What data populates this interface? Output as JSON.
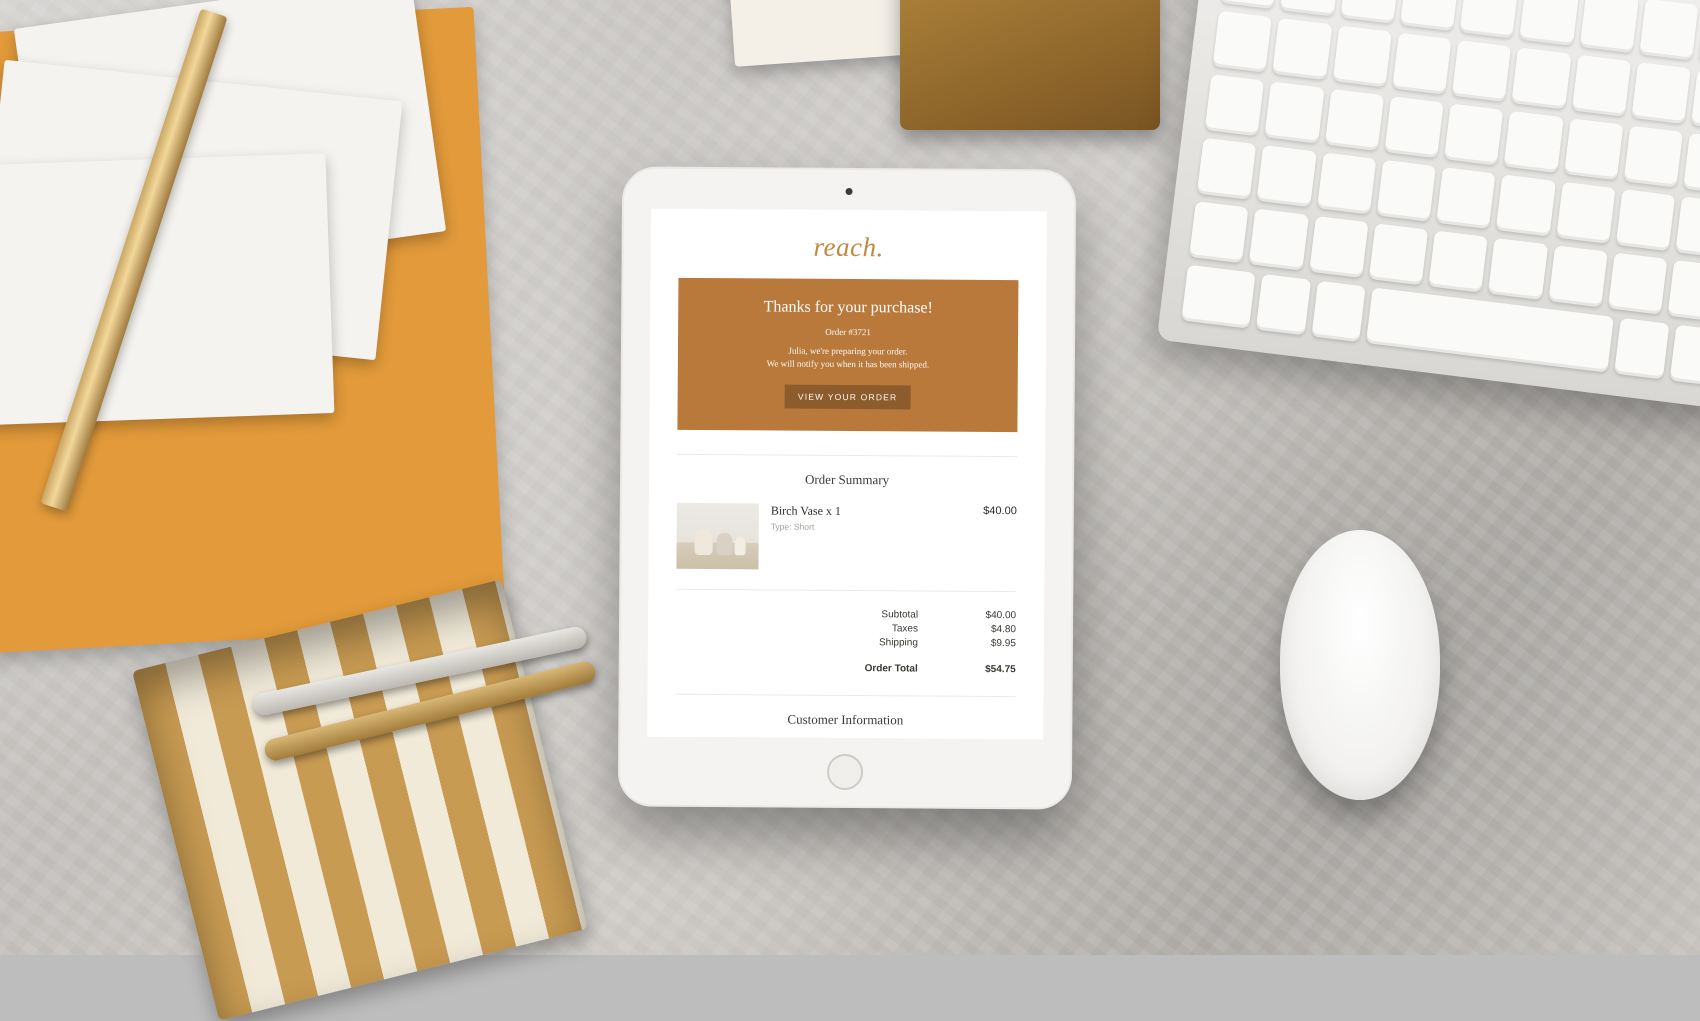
{
  "brand": "reach.",
  "hero": {
    "title": "Thanks for your purchase!",
    "order_label": "Order #3721",
    "message_line1": "Julia, we're preparing your order.",
    "message_line2": "We will notify you when it has been shipped.",
    "button": "VIEW  YOUR ORDER"
  },
  "sections": {
    "order_summary": "Order Summary",
    "customer_info": "Customer Information"
  },
  "line_item": {
    "name": "Birch Vase x 1",
    "type_label": "Type: Short",
    "price": "$40.00"
  },
  "totals": {
    "subtotal_label": "Subtotal",
    "subtotal_value": "$40.00",
    "taxes_label": "Taxes",
    "taxes_value": "$4.80",
    "shipping_label": "Shipping",
    "shipping_value": "$9.95",
    "total_label": "Order Total",
    "total_value": "$54.75"
  }
}
